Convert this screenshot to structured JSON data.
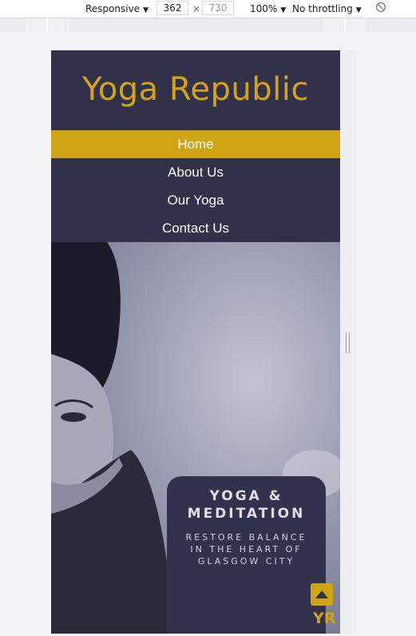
{
  "devtools": {
    "device": "Responsive",
    "width": "362",
    "times": "×",
    "height": "730",
    "zoom": "100%",
    "throttle": "No throttling"
  },
  "site": {
    "title": "Yoga Republic",
    "nav": [
      "Home",
      "About Us",
      "Our Yoga",
      "Contact Us"
    ],
    "active_nav": "Home",
    "hero_title_1": "YOGA &",
    "hero_title_2": "MEDITATION",
    "hero_subtitle": "RESTORE BALANCE IN THE HEART OF GLASGOW CITY",
    "badge": "YR"
  },
  "colors": {
    "brand_gold": "#d0a414",
    "navy": "#32314a"
  },
  "icons": {
    "back_to_top": "triangle-up-icon",
    "rotate": "no-rotate-icon"
  }
}
